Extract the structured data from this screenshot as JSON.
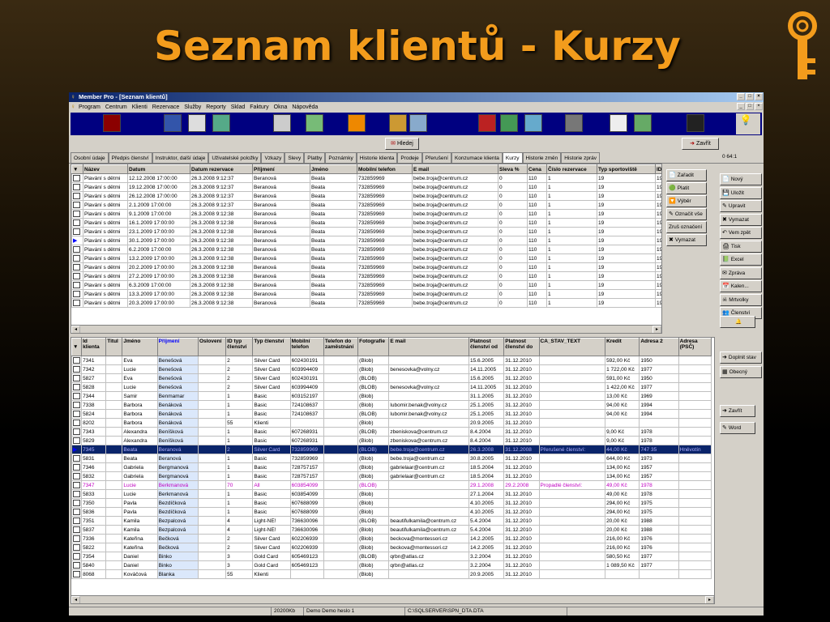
{
  "slide_title": "Seznam klientů - Kurzy",
  "app": {
    "title": "Member Pro - [Seznam klientů]",
    "menu": [
      "Program",
      "Centrum",
      "Klienti",
      "Rezervace",
      "Služby",
      "Reporty",
      "Sklad",
      "Faktury",
      "Okna",
      "Nápověda"
    ],
    "toolbar_icons": [
      "member-card-icon",
      "calendar-icon",
      "notes-icon",
      "photo-icon",
      "board-icon",
      "money-icon",
      "color-icon",
      "gift-icon",
      "basket-icon",
      "stop-icon",
      "monitor-icon",
      "chart-icon",
      "printer-icon",
      "person-icon",
      "map-icon",
      "help-icon",
      "bulb-icon"
    ],
    "search_label": "Hledej",
    "close_label": "Zavřít",
    "counter": "0 64:1",
    "tabs": [
      "Osobní údaje",
      "Předpis členství",
      "Instruktor, další údaje",
      "Uživatelské položky",
      "Vzkazy",
      "Slevy",
      "Platby",
      "Poznámky",
      "Historie klienta",
      "Prodeje",
      "Přerušení",
      "Konzumace klienta",
      "Kurzy",
      "Historie změn",
      "Historie zpráv"
    ],
    "active_tab": "Kurzy",
    "upper": {
      "columns": [
        "Název",
        "Datum",
        "Datum rezervace",
        "Příjmení",
        "Jméno",
        "Mobilní telefon",
        "E mail",
        "Sleva %",
        "Cena",
        "Číslo rezervace",
        "Typ sportoviště",
        "ID"
      ],
      "rows": [
        [
          "Plavání s dětmi",
          "12.12.2008 17:00:00",
          "26.3.2008 9:12:37",
          "Beranová",
          "Beata",
          "732859969",
          "bebe.troja@centrum.cz",
          "0",
          "110",
          "1",
          "19",
          "19"
        ],
        [
          "Plavání s dětmi",
          "19.12.2008 17:00:00",
          "26.3.2008 9:12:37",
          "Beranová",
          "Beata",
          "732859969",
          "bebe.troja@centrum.cz",
          "0",
          "110",
          "1",
          "19",
          "19"
        ],
        [
          "Plavání s dětmi",
          "26.12.2008 17:00:00",
          "26.3.2008 9:12:37",
          "Beranová",
          "Beata",
          "732859969",
          "bebe.troja@centrum.cz",
          "0",
          "110",
          "1",
          "19",
          "19"
        ],
        [
          "Plavání s dětmi",
          "2.1.2009 17:00:00",
          "26.3.2008 9:12:37",
          "Beranová",
          "Beata",
          "732859969",
          "bebe.troja@centrum.cz",
          "0",
          "110",
          "1",
          "19",
          "19"
        ],
        [
          "Plavání s dětmi",
          "9.1.2009 17:00:00",
          "26.3.2008 9:12:38",
          "Beranová",
          "Beata",
          "732859969",
          "bebe.troja@centrum.cz",
          "0",
          "110",
          "1",
          "19",
          "19"
        ],
        [
          "Plavání s dětmi",
          "16.1.2009 17:00:00",
          "26.3.2008 9:12:38",
          "Beranová",
          "Beata",
          "732859969",
          "bebe.troja@centrum.cz",
          "0",
          "110",
          "1",
          "19",
          "19"
        ],
        [
          "Plavání s dětmi",
          "23.1.2009 17:00:00",
          "26.3.2008 9:12:38",
          "Beranová",
          "Beata",
          "732859969",
          "bebe.troja@centrum.cz",
          "0",
          "110",
          "1",
          "19",
          "19"
        ],
        [
          "Plavání s dětmi",
          "30.1.2009 17:00:00",
          "26.3.2008 9:12:38",
          "Beranová",
          "Beata",
          "732859969",
          "bebe.troja@centrum.cz",
          "0",
          "110",
          "1",
          "19",
          "19"
        ],
        [
          "Plavání s dětmi",
          "6.2.2009 17:00:00",
          "26.3.2008 9:12:38",
          "Beranová",
          "Beata",
          "732859969",
          "bebe.troja@centrum.cz",
          "0",
          "110",
          "1",
          "19",
          "19"
        ],
        [
          "Plavání s dětmi",
          "13.2.2009 17:00:00",
          "26.3.2008 9:12:38",
          "Beranová",
          "Beata",
          "732859969",
          "bebe.troja@centrum.cz",
          "0",
          "110",
          "1",
          "19",
          "19"
        ],
        [
          "Plavání s dětmi",
          "20.2.2009 17:00:00",
          "26.3.2008 9:12:38",
          "Beranová",
          "Beata",
          "732859969",
          "bebe.troja@centrum.cz",
          "0",
          "110",
          "1",
          "19",
          "19"
        ],
        [
          "Plavání s dětmi",
          "27.2.2009 17:00:00",
          "26.3.2008 9:12:38",
          "Beranová",
          "Beata",
          "732859969",
          "bebe.troja@centrum.cz",
          "0",
          "110",
          "1",
          "19",
          "19"
        ],
        [
          "Plavání s dětmi",
          "6.3.2009 17:00:00",
          "26.3.2008 9:12:38",
          "Beranová",
          "Beata",
          "732859969",
          "bebe.troja@centrum.cz",
          "0",
          "110",
          "1",
          "19",
          "19"
        ],
        [
          "Plavání s dětmi",
          "13.3.2009 17:00:00",
          "26.3.2008 9:12:38",
          "Beranová",
          "Beata",
          "732859969",
          "bebe.troja@centrum.cz",
          "0",
          "110",
          "1",
          "19",
          "19"
        ],
        [
          "Plavání s dětmi",
          "20.3.2009 17:00:00",
          "26.3.2008 9:12:38",
          "Beranová",
          "Beata",
          "732859969",
          "bebe.troja@centrum.cz",
          "0",
          "110",
          "1",
          "19",
          "19"
        ]
      ],
      "current_row": 7
    },
    "upper_buttons": [
      "Zařadit",
      "Platit",
      "Výběr",
      "Označit vše",
      "Zruš označení",
      "Vymazat"
    ],
    "right_buttons": [
      "Nový",
      "Uložit",
      "Upravit",
      "Vymazat",
      "Vem zpět",
      "Tisk",
      "Excel",
      "Zpráva",
      "Kalen...",
      "Mrtvolky",
      "Členství"
    ],
    "right_buttons2": [
      "Doplnit stav",
      "Obecný"
    ],
    "right_buttons3": [
      "Zavřít",
      "Word"
    ],
    "lower": {
      "columns": [
        "Id klienta",
        "Titul",
        "Jméno",
        "Příjmení",
        "Oslovení",
        "ID typ členství",
        "Typ členství",
        "Mobilní telefon",
        "Telefon do zaměstnání",
        "Fotografie",
        "E mail",
        "Platnost členství od",
        "Platnost členství do",
        "CA_STAV_TEXT",
        "Kredit",
        "Adresa 2",
        "Adresa (PSČ)"
      ],
      "rows": [
        [
          "7341",
          "",
          "Eva",
          "Benešová",
          "",
          "2",
          "Silver Card",
          "602430191",
          "",
          "(Blob)",
          "",
          "15.6.2005",
          "31.12.2010",
          "",
          "592,00 Kč",
          "1950",
          ""
        ],
        [
          "7342",
          "",
          "Lucie",
          "Benešová",
          "",
          "2",
          "Silver Card",
          "603994409",
          "",
          "(Blob)",
          "benesovka@volny.cz",
          "14.11.2005",
          "31.12.2010",
          "",
          "1 722,00 Kč",
          "1977",
          ""
        ],
        [
          "5827",
          "",
          "Eva",
          "Benešová",
          "",
          "2",
          "Silver Card",
          "602430191",
          "",
          "(BLOB)",
          "",
          "15.6.2005",
          "31.12.2010",
          "",
          "591,00 Kč",
          "1950",
          ""
        ],
        [
          "5828",
          "",
          "Lucie",
          "Benešová",
          "",
          "2",
          "Silver Card",
          "603994409",
          "",
          "(BLOB)",
          "benesovka@volny.cz",
          "14.11.2005",
          "31.12.2010",
          "",
          "1 422,00 Kč",
          "1977",
          ""
        ],
        [
          "7344",
          "",
          "Samir",
          "Benmamar",
          "",
          "1",
          "Basic",
          "603152197",
          "",
          "(Blob)",
          "",
          "31.1.2005",
          "31.12.2010",
          "",
          "13,00 Kč",
          "1969",
          ""
        ],
        [
          "7338",
          "",
          "Barbora",
          "Benáková",
          "",
          "1",
          "Basic",
          "724108637",
          "",
          "(Blob)",
          "lubomir.benak@volny.cz",
          "25.1.2005",
          "31.12.2010",
          "",
          "94,00 Kč",
          "1994",
          ""
        ],
        [
          "5824",
          "",
          "Barbora",
          "Benáková",
          "",
          "1",
          "Basic",
          "724108637",
          "",
          "(BLOB)",
          "lubomir.benak@volny.cz",
          "25.1.2005",
          "31.12.2010",
          "",
          "94,00 Kč",
          "1994",
          ""
        ],
        [
          "8202",
          "",
          "Barbora",
          "Benáková",
          "",
          "55",
          "Klienti",
          "",
          "",
          "(Blob)",
          "",
          "20.9.2005",
          "31.12.2010",
          "",
          "",
          "",
          ""
        ],
        [
          "7343",
          "",
          "Alexandra",
          "Beníšková",
          "",
          "1",
          "Basic",
          "607268931",
          "",
          "(BLOB)",
          "zbeniskova@centrum.cz",
          "8.4.2004",
          "31.12.2010",
          "",
          "9,00 Kč",
          "1978",
          ""
        ],
        [
          "5829",
          "",
          "Alexandra",
          "Beníšková",
          "",
          "1",
          "Basic",
          "607268931",
          "",
          "(Blob)",
          "zbeniskova@centrum.cz",
          "8.4.2004",
          "31.12.2010",
          "",
          "9,00 Kč",
          "1978",
          ""
        ],
        [
          "7345",
          "",
          "Beata",
          "Beranová",
          "",
          "2",
          "Silver Card",
          "732859969",
          "",
          "(BLOB)",
          "bebe.troja@centrum.cz",
          "26.3.2008",
          "31.12.2008",
          "Přerušené členství:",
          "44,00 Kč",
          "747 35",
          "Hněvotín"
        ],
        [
          "5831",
          "",
          "Beata",
          "Beranová",
          "",
          "1",
          "Basic",
          "732859969",
          "",
          "(Blob)",
          "bebe.troja@centrum.cz",
          "30.8.2005",
          "31.12.2010",
          "",
          "644,00 Kč",
          "1973",
          ""
        ],
        [
          "7346",
          "",
          "Gabriela",
          "Bergmanová",
          "",
          "1",
          "Basic",
          "728757157",
          "",
          "(Blob)",
          "gabrielaar@centrum.cz",
          "18.5.2004",
          "31.12.2010",
          "",
          "134,00 Kč",
          "1957",
          ""
        ],
        [
          "5832",
          "",
          "Gabriela",
          "Bergmanová",
          "",
          "1",
          "Basic",
          "728757157",
          "",
          "(Blob)",
          "gabrielaar@centrum.cz",
          "18.5.2004",
          "31.12.2010",
          "",
          "134,00 Kč",
          "1957",
          ""
        ],
        [
          "7347",
          "",
          "Lucie",
          "Berkmanová",
          "",
          "70",
          "All",
          "603854099",
          "",
          "(BLOB)",
          "",
          "29.1.2008",
          "29.2.2008",
          "Propadlé členství:",
          "49,00 Kč",
          "1978",
          ""
        ],
        [
          "5833",
          "",
          "Lucie",
          "Berkmanová",
          "",
          "1",
          "Basic",
          "603854099",
          "",
          "(Blob)",
          "",
          "27.1.2004",
          "31.12.2010",
          "",
          "49,00 Kč",
          "1978",
          ""
        ],
        [
          "7350",
          "",
          "Pavla",
          "Bezdíčková",
          "",
          "1",
          "Basic",
          "607688099",
          "",
          "(Blob)",
          "",
          "4.10.2005",
          "31.12.2010",
          "",
          "294,00 Kč",
          "1975",
          ""
        ],
        [
          "5836",
          "",
          "Pavla",
          "Bezdíčková",
          "",
          "1",
          "Basic",
          "607688099",
          "",
          "(Blob)",
          "",
          "4.10.2005",
          "31.12.2010",
          "",
          "294,00 Kč",
          "1975",
          ""
        ],
        [
          "7351",
          "",
          "Kamila",
          "Bezpalcová",
          "",
          "4",
          "Light-NE!",
          "736630096",
          "",
          "(BLOB)",
          "beautifulkamila@centrum.cz",
          "5.4.2004",
          "31.12.2010",
          "",
          "20,00 Kč",
          "1988",
          ""
        ],
        [
          "5837",
          "",
          "Kamila",
          "Bezpalcová",
          "",
          "4",
          "Light-NE!",
          "736630096",
          "",
          "(Blob)",
          "beautifulkamila@centrum.cz",
          "5.4.2004",
          "31.12.2010",
          "",
          "20,00 Kč",
          "1988",
          ""
        ],
        [
          "7336",
          "",
          "Kateřina",
          "Bečková",
          "",
          "2",
          "Silver Card",
          "602206939",
          "",
          "(Blob)",
          "beckova@montessori.cz",
          "14.2.2005",
          "31.12.2010",
          "",
          "216,00 Kč",
          "1976",
          ""
        ],
        [
          "5822",
          "",
          "Kateřina",
          "Bečková",
          "",
          "2",
          "Silver Card",
          "602206939",
          "",
          "(Blob)",
          "beckova@montessori.cz",
          "14.2.2005",
          "31.12.2010",
          "",
          "216,00 Kč",
          "1976",
          ""
        ],
        [
          "7354",
          "",
          "Daniel",
          "Binko",
          "",
          "3",
          "Gold Card",
          "605469123",
          "",
          "(BLOB)",
          "qrbn@atlas.cz",
          "3.2.2004",
          "31.12.2010",
          "",
          "580,50 Kč",
          "1977",
          ""
        ],
        [
          "5840",
          "",
          "Daniel",
          "Binko",
          "",
          "3",
          "Gold Card",
          "605469123",
          "",
          "(Blob)",
          "qrbn@atlas.cz",
          "3.2.2004",
          "31.12.2010",
          "",
          "1 089,50 Kč",
          "1977",
          ""
        ],
        [
          "8068",
          "",
          "Kováčová",
          "Blanka",
          "",
          "55",
          "Klienti",
          "",
          "",
          "(Blob)",
          "",
          "20.9.2005",
          "31.12.2010",
          "",
          "",
          "",
          ""
        ]
      ],
      "selected_row": 10,
      "pink_rows": [
        14
      ]
    },
    "status": [
      "",
      "20200Kb",
      "Demo Demo heslo 1",
      "C:\\SQLSERVER\\SPN_DTA.DTA"
    ]
  }
}
